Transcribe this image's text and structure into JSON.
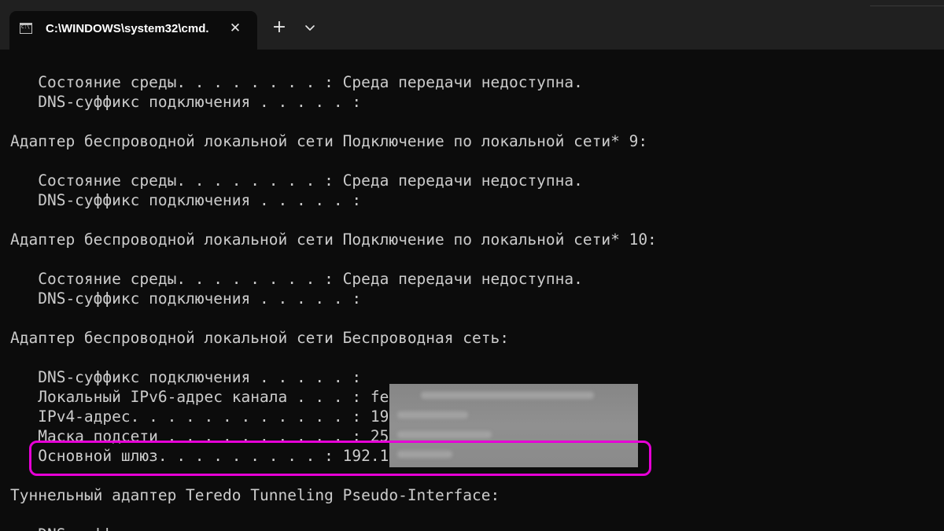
{
  "window": {
    "tab_title": "C:\\WINDOWS\\system32\\cmd.",
    "tab_icon_text": "C:\\",
    "close_glyph": "✕",
    "new_tab_glyph": "+",
    "highlight_color": "#e600d6"
  },
  "console": {
    "lines": [
      "   Состояние среды. . . . . . . . : Среда передачи недоступна.",
      "   DNS-суффикс подключения . . . . . :",
      "",
      "Адаптер беспроводной локальной сети Подключение по локальной сети* 9:",
      "",
      "   Состояние среды. . . . . . . . : Среда передачи недоступна.",
      "   DNS-суффикс подключения . . . . . :",
      "",
      "Адаптер беспроводной локальной сети Подключение по локальной сети* 10:",
      "",
      "   Состояние среды. . . . . . . . : Среда передачи недоступна.",
      "   DNS-суффикс подключения . . . . . :",
      "",
      "Адаптер беспроводной локальной сети Беспроводная сеть:",
      "",
      "   DNS-суффикс подключения . . . . . :",
      "   Локальный IPv6-адрес канала . . . : fe",
      "   IPv4-адрес. . . . . . . . . . . . : 19",
      "   Маска подсети . . . . . . . . . . : 25",
      "   Основной шлюз. . . . . . . . . : 192.1",
      "",
      "Туннельный адаптер Teredo Tunneling Pseudo-Interface:",
      "",
      "   DNS-суффикс подключения . . . . . :"
    ]
  }
}
